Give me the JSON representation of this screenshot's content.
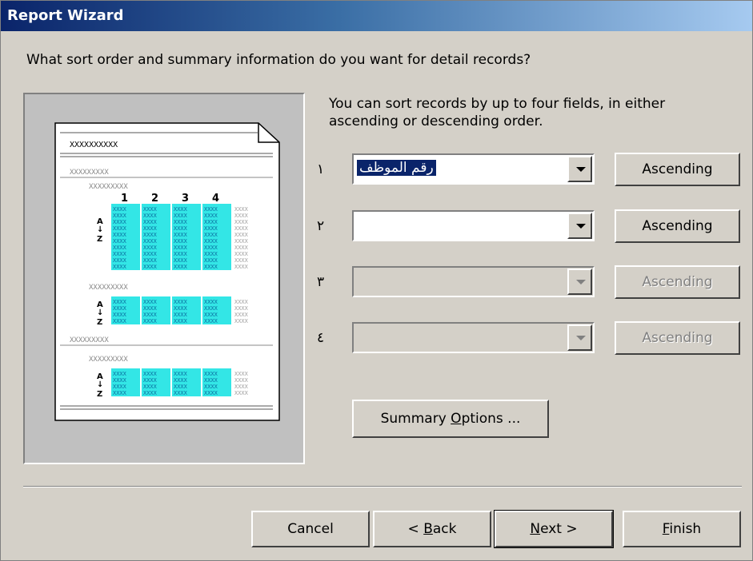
{
  "window": {
    "title": "Report Wizard"
  },
  "question": "What sort order and summary information do you want for detail records?",
  "instruction": "You can sort records by up to four fields, in either ascending or descending order.",
  "preview": {
    "placeholder_long": "XXXXXXXXXX",
    "placeholder_short": "XXXXXXXXX",
    "cell_text": "XXXX",
    "column_numbers": [
      "1",
      "2",
      "3",
      "4"
    ],
    "sort_marks": [
      "A",
      "↓",
      "Z"
    ]
  },
  "sort_fields": [
    {
      "number": "١",
      "value": "رقم الموظف",
      "order": "Ascending",
      "enabled": true
    },
    {
      "number": "٢",
      "value": "",
      "order": "Ascending",
      "enabled": true
    },
    {
      "number": "٣",
      "value": "",
      "order": "Ascending",
      "enabled": false
    },
    {
      "number": "٤",
      "value": "",
      "order": "Ascending",
      "enabled": false
    }
  ],
  "buttons": {
    "summary_options": {
      "before": "Summary ",
      "mnemonic": "O",
      "after": "ptions ..."
    },
    "cancel": "Cancel",
    "back": {
      "before": "< ",
      "mnemonic": "B",
      "after": "ack"
    },
    "next": {
      "before": "",
      "mnemonic": "N",
      "after": "ext >"
    },
    "finish": {
      "before": "",
      "mnemonic": "F",
      "after": "inish"
    }
  },
  "colors": {
    "title_bar_start": "#0a246a",
    "title_bar_end": "#a6caf0",
    "face": "#d4d0c8",
    "preview_highlight": "#33e6e6"
  }
}
